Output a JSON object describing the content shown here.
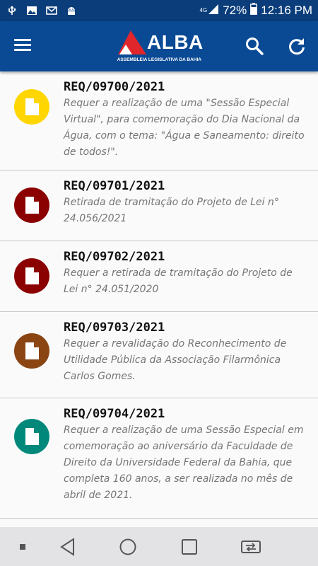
{
  "status_bar": {
    "signal_label": "4G",
    "battery_percent": "72%",
    "time": "12:16 PM",
    "left_icons": [
      "usb-icon",
      "image-icon",
      "gmail-icon",
      "android-icon"
    ]
  },
  "header": {
    "logo_text": "ALBA",
    "logo_subtitle": "ASSEMBLEIA LEGISLATIVA DA BAHIA",
    "brand_colors": {
      "bar": "#0a4a95",
      "logo_red": "#e0262b"
    }
  },
  "list": {
    "items": [
      {
        "title": "REQ/09700/2021",
        "description": "Requer a realização de uma \"Sessão Especial Virtual\", para comemoração do Dia Nacional da Água, com o tema: \"Água e Saneamento: direito de todos!\".",
        "icon": "document-icon",
        "color": "#ffd600"
      },
      {
        "title": "REQ/09701/2021",
        "description": "Retirada de tramitação do Projeto de Lei n° 24.056/2021",
        "icon": "document-icon",
        "color": "#8b0000"
      },
      {
        "title": "REQ/09702/2021",
        "description": "Requer a retirada de tramitação do Projeto de Lei n° 24.051/2020",
        "icon": "document-icon",
        "color": "#8b0000"
      },
      {
        "title": "REQ/09703/2021",
        "description": "Requer a revalidação do Reconhecimento de Utilidade Pública da Associação Filarmônica Carlos Gomes.",
        "icon": "document-icon",
        "color": "#8b4513"
      },
      {
        "title": "REQ/09704/2021",
        "description": "Requer a realização de uma Sessão Especial em comemoração ao aniversário da Faculdade de Direito da Universidade Federal da Bahia, que completa 160 anos, a ser realizada no mês de abril de 2021.",
        "icon": "document-icon",
        "color": "#00897b"
      }
    ]
  },
  "nav_bar": {
    "buttons": [
      "dot-icon",
      "back-icon",
      "home-icon",
      "recents-icon",
      "switch-app-icon"
    ]
  }
}
